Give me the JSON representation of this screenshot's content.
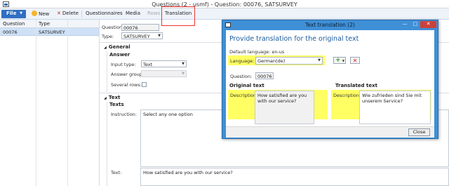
{
  "window": {
    "title": "Questions (2 - usmf) - Question: 00076, SATSURVEY"
  },
  "toolbar": {
    "file_label": "File",
    "new_label": "New",
    "delete_label": "Delete",
    "questionnaires_label": "Questionnaires",
    "media_label": "Media",
    "rows_label": "Rows",
    "translation_label": "Translation"
  },
  "list": {
    "columns": [
      "Question",
      "Type"
    ],
    "rows": [
      {
        "question": "00076",
        "type": "SATSURVEY"
      }
    ]
  },
  "form": {
    "question_label": "Question:",
    "question_value": "00076",
    "type_label": "Type:",
    "type_value": "SATSURVEY",
    "general_section": "General",
    "answer_group": "Answer",
    "input_type_label": "Input type:",
    "input_type_value": "Text",
    "answer_group_label": "Answer group:",
    "answer_group_value": "",
    "several_rows_label": "Several rows:",
    "text_section": "Text",
    "texts_group": "Texts",
    "instruction_label": "Instruction:",
    "instruction_value": "Select any one option",
    "text_label": "Text:",
    "text_value": "How satisfied are you with our service?"
  },
  "dialog": {
    "title": "Text translation (2)",
    "heading": "Provide translation for the original text",
    "default_language_label": "Default language: en-us",
    "language_label": "Language:",
    "language_value": "German(de)",
    "question_label": "Question:",
    "question_value": "00076",
    "original_text_heading": "Original text",
    "translated_text_heading": "Translated text",
    "description_label": "Description:",
    "original_description": "How satisfied are you with our service?",
    "translated_description": "Wie zufrieden sind Sie mit unserem Service?",
    "close_label": "Close",
    "min_glyph": "—",
    "max_glyph": "□",
    "close_glyph": "✕"
  },
  "colors": {
    "highlight": "#ffff63",
    "dialog_frame": "#3f8fd6",
    "accent_box": "#e33333",
    "file_button": "#2f6fc3",
    "selected_row": "#cfe1f7"
  }
}
